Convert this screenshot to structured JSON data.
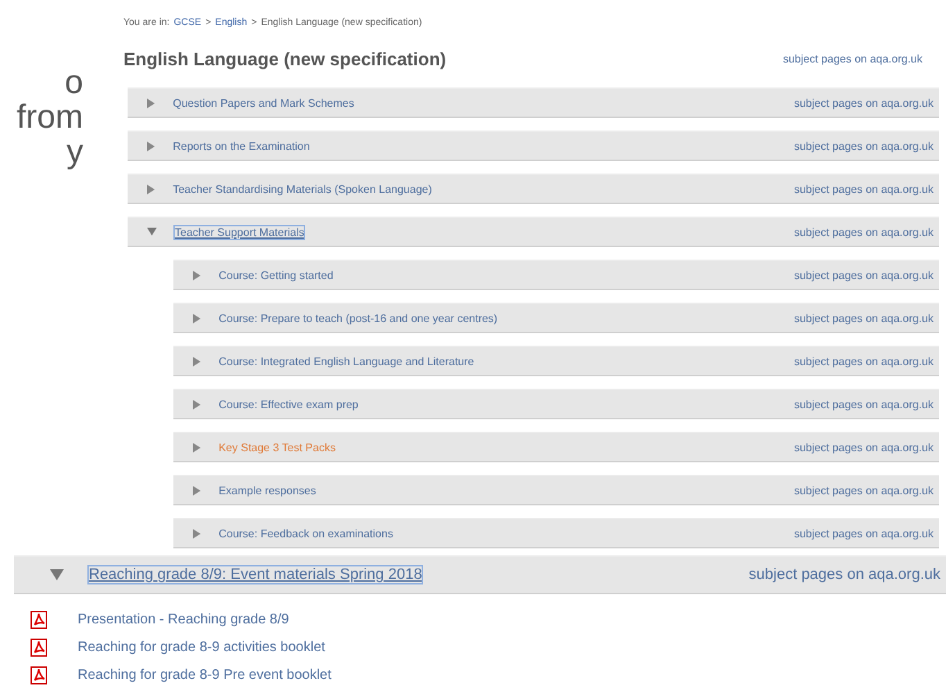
{
  "slide_text": [
    "o",
    "from",
    "y"
  ],
  "breadcrumb": [
    {
      "kind": "text",
      "text": "You are in:"
    },
    {
      "kind": "link",
      "text": "GCSE"
    },
    {
      "kind": "separator",
      "text": ">"
    },
    {
      "kind": "link",
      "text": "English"
    },
    {
      "kind": "separator",
      "text": ">"
    },
    {
      "kind": "text",
      "text": "English Language (new specification)"
    }
  ],
  "heading": {
    "title": "English Language (new specification)",
    "link": "subject pages on aqa.org.uk"
  },
  "sections": [
    {
      "title": "Question Papers and Mark Schemes",
      "link": "subject pages on aqa.org.uk",
      "expanded": false,
      "focused": false
    },
    {
      "title": "Reports on the Examination",
      "link": "subject pages on aqa.org.uk",
      "expanded": false,
      "focused": false
    },
    {
      "title": "Teacher Standardising Materials (Spoken Language)",
      "link": "subject pages on aqa.org.uk",
      "expanded": false,
      "focused": false
    },
    {
      "title": "Teacher Support Materials",
      "link": "subject pages on aqa.org.uk",
      "expanded": true,
      "focused": true,
      "children": [
        {
          "title": "Course: Getting started",
          "link": "subject pages on aqa.org.uk",
          "expanded": false,
          "visited": false
        },
        {
          "title": "Course: Prepare to teach (post-16 and one year centres)",
          "link": "subject pages on aqa.org.uk",
          "expanded": false,
          "visited": false
        },
        {
          "title": "Course: Integrated English Language and Literature",
          "link": "subject pages on aqa.org.uk",
          "expanded": false,
          "visited": false
        },
        {
          "title": "Course: Effective exam prep",
          "link": "subject pages on aqa.org.uk",
          "expanded": false,
          "visited": false
        },
        {
          "title": "Key Stage 3 Test Packs",
          "link": "subject pages on aqa.org.uk",
          "expanded": false,
          "visited": true
        },
        {
          "title": "Example responses",
          "link": "subject pages on aqa.org.uk",
          "expanded": false,
          "visited": false
        },
        {
          "title": "Course: Feedback on examinations",
          "link": "subject pages on aqa.org.uk",
          "expanded": false,
          "visited": false
        }
      ]
    }
  ],
  "callout": {
    "title": "Reaching grade 8/9: Event materials Spring 2018",
    "link": "subject pages on aqa.org.uk",
    "expanded": true,
    "focused": true,
    "files": [
      {
        "kind": "pdf",
        "title": "Presentation - Reaching grade 8/9"
      },
      {
        "kind": "pdf",
        "title": "Reaching for grade 8-9 activities booklet"
      },
      {
        "kind": "pdf",
        "title": "Reaching for grade 8-9 Pre event booklet"
      }
    ]
  }
}
